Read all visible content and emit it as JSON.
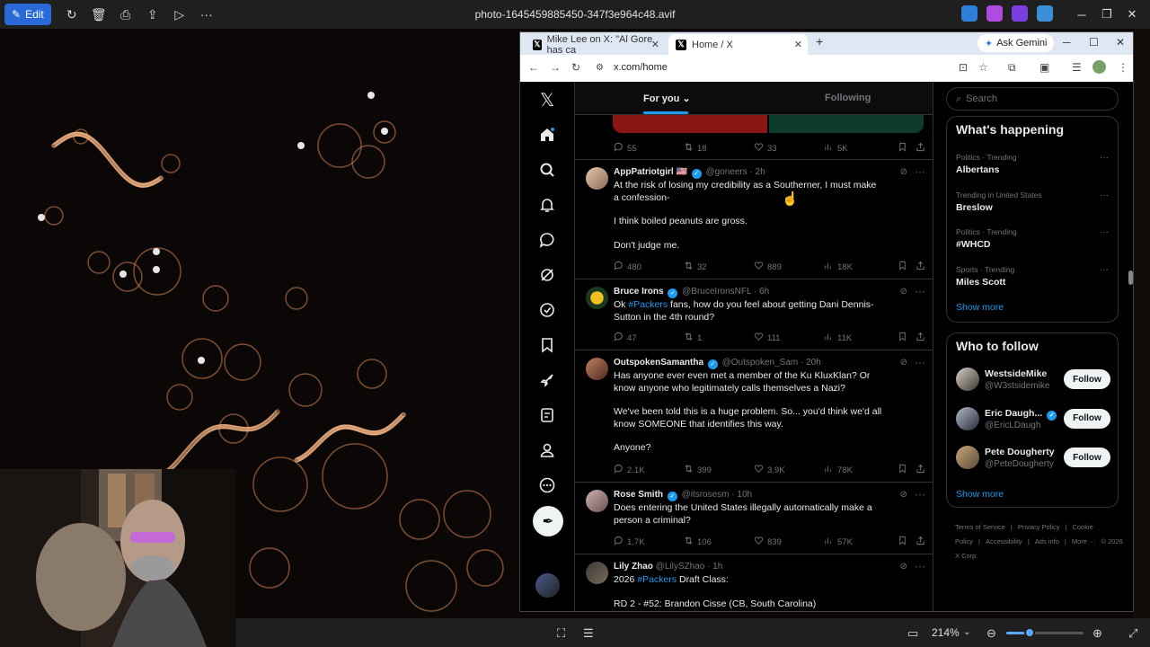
{
  "viewer": {
    "edit_label": "Edit",
    "filename": "photo-1645459885450-347f3e964c48.avif",
    "zoom": "214%",
    "zoom_level": 0.3
  },
  "browser": {
    "tabs": [
      {
        "label": "Mike Lee on X: \"Al Gore has ca",
        "active": false
      },
      {
        "label": "Home / X",
        "active": true
      }
    ],
    "gemini_label": "Ask Gemini",
    "url": "x.com/home"
  },
  "x": {
    "feed_tabs": {
      "for_you": "For you",
      "following": "Following"
    },
    "top_post_stats": {
      "replies": "55",
      "reposts": "18",
      "likes": "33",
      "views": "5K"
    },
    "posts": [
      {
        "name": "AppPatriotgirl",
        "flag": "🇺🇸",
        "verified": true,
        "handle": "@goneers · 2h",
        "body": [
          "At the risk of losing my credibility as a Southerner, I must make a confession-",
          "I think boiled peanuts are gross.",
          "Don't judge me."
        ],
        "replies": "480",
        "reposts": "32",
        "likes": "889",
        "views": "18K"
      },
      {
        "name": "Bruce Irons",
        "verified": true,
        "handle": "@BruceIronsNFL · 6h",
        "body_pre": "Ok ",
        "hashtag": "#Packers",
        "body_post": " fans, how do you feel about getting Dani Dennis-Sutton in the 4th round?",
        "replies": "47",
        "reposts": "1",
        "likes": "111",
        "views": "11K"
      },
      {
        "name": "OutspokenSamantha",
        "verified": true,
        "handle": "@Outspoken_Sam · 20h",
        "body": [
          "Has anyone ever even met a member of the Ku KluxKlan? Or know anyone who legitimately calls themselves a Nazi?",
          "We've been told this is a huge problem. So... you'd think we'd all know SOMEONE that identifies this way.",
          "Anyone?"
        ],
        "replies": "2.1K",
        "reposts": "399",
        "likes": "3.9K",
        "views": "78K"
      },
      {
        "name": "Rose Smith",
        "verified": true,
        "handle": "@itsrosesm · 10h",
        "body": [
          "Does entering the United States illegally automatically make a person a criminal?"
        ],
        "replies": "1.7K",
        "reposts": "106",
        "likes": "839",
        "views": "57K"
      },
      {
        "name": "Lily Zhao",
        "verified": false,
        "handle": "@LilySZhao · 1h",
        "body_pre": "2026 ",
        "hashtag": "#Packers",
        "body_post": " Draft Class:",
        "body_extra": "RD 2 - #52: Brandon Cisse (CB, South Carolina)"
      }
    ],
    "search_placeholder": "Search",
    "happening": {
      "title": "What's happening",
      "trends": [
        {
          "meta": "Politics · Trending",
          "name": "Albertans"
        },
        {
          "meta": "Trending in United States",
          "name": "Breslow"
        },
        {
          "meta": "Politics · Trending",
          "name": "#WHCD"
        },
        {
          "meta": "Sports · Trending",
          "name": "Miles Scott"
        }
      ],
      "show_more": "Show more"
    },
    "who_to_follow": {
      "title": "Who to follow",
      "accounts": [
        {
          "name": "WestsideMike",
          "handle": "@W3stsidemike",
          "follow": "Follow"
        },
        {
          "name": "Eric Daugh...",
          "handle": "@EricLDaugh",
          "follow": "Follow"
        },
        {
          "name": "Pete Dougherty",
          "handle": "@PeteDougherty",
          "follow": "Follow"
        }
      ],
      "show_more": "Show more"
    },
    "footer": [
      "Terms of Service",
      "|",
      "Privacy Policy",
      "|",
      "Cookie Policy",
      "|",
      "Accessibility",
      "|",
      "Ads info",
      "|",
      "More ···",
      "© 2026 X Corp."
    ]
  },
  "colors": {
    "accent": "#1d9bf0",
    "edit_button": "#2a6ad8",
    "photo_glow": "#d8865a"
  }
}
